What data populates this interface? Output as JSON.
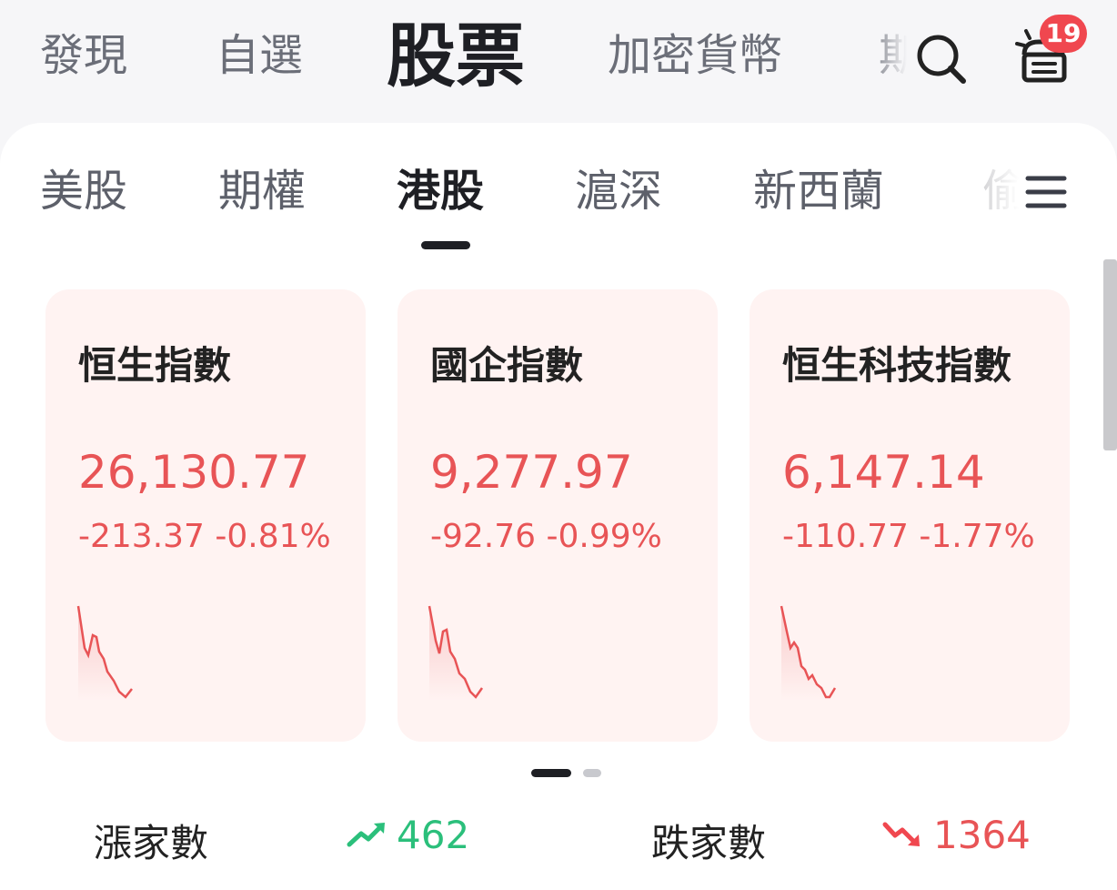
{
  "top_tabs": [
    {
      "label": "發現",
      "active": false
    },
    {
      "label": "自選",
      "active": false
    },
    {
      "label": "股票",
      "active": true
    },
    {
      "label": "加密貨幣",
      "active": false
    },
    {
      "label": "期",
      "active": false
    }
  ],
  "header": {
    "search_icon": "search-icon",
    "notification_icon": "notification-icon",
    "notification_count": "19"
  },
  "sub_tabs": [
    {
      "label": "美股",
      "active": false
    },
    {
      "label": "期權",
      "active": false
    },
    {
      "label": "港股",
      "active": true
    },
    {
      "label": "滬深",
      "active": false
    },
    {
      "label": "新西蘭",
      "active": false
    },
    {
      "label": "偷",
      "active": false
    }
  ],
  "menu_icon": "menu-icon",
  "index_cards": [
    {
      "name": "恒生指數",
      "value": "26,130.77",
      "change": "-213.37 -0.81%",
      "trend": "down"
    },
    {
      "name": "國企指數",
      "value": "9,277.97",
      "change": "-92.76 -0.99%",
      "trend": "down"
    },
    {
      "name": "恒生科技指數",
      "value": "6,147.14",
      "change": "-110.77 -1.77%",
      "trend": "down"
    }
  ],
  "pager": {
    "pages": 2,
    "current": 1
  },
  "market_breadth": {
    "up_label": "漲家數",
    "up_count": "462",
    "up_icon": "trend-up-icon",
    "down_label": "跌家數",
    "down_count": "1364",
    "down_icon": "trend-down-icon"
  },
  "colors": {
    "up": "#2bbf7b",
    "down": "#e85456",
    "accent_dark": "#1e1f24",
    "badge": "#f0474f",
    "card_bg": "#fff3f2"
  }
}
